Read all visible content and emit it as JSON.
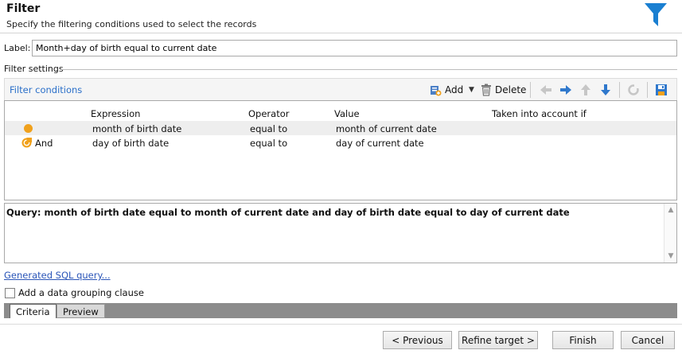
{
  "header": {
    "title": "Filter",
    "subtitle": "Specify the filtering conditions used to select the records"
  },
  "label": {
    "caption": "Label:",
    "value": "Month+day of birth equal to current date"
  },
  "filter_settings_title": "Filter settings",
  "toolbar": {
    "section_title": "Filter conditions",
    "add_label": "Add",
    "delete_label": "Delete"
  },
  "grid": {
    "columns": [
      "Expression",
      "Operator",
      "Value",
      "Taken into account if"
    ],
    "rows": [
      {
        "prefix": "",
        "expression": "month of birth date",
        "operator": "equal to",
        "value": "month of current date",
        "condition": ""
      },
      {
        "prefix": "And",
        "expression": "day of birth date",
        "operator": "equal to",
        "value": "day of current date",
        "condition": ""
      }
    ]
  },
  "query_text": "Query: month of birth date equal to month of current date and day of birth date equal to day of current date",
  "sql_link": "Generated SQL query...",
  "grouping_label": "Add a data grouping clause",
  "tabs": {
    "criteria": "Criteria",
    "preview": "Preview"
  },
  "buttons": {
    "previous": "< Previous",
    "refine": "Refine target >",
    "finish": "Finish",
    "cancel": "Cancel"
  },
  "colors": {
    "accent_blue": "#2a6fc9",
    "orange_dot": "#f0a11c",
    "funnel_blue": "#1a7fd1"
  }
}
